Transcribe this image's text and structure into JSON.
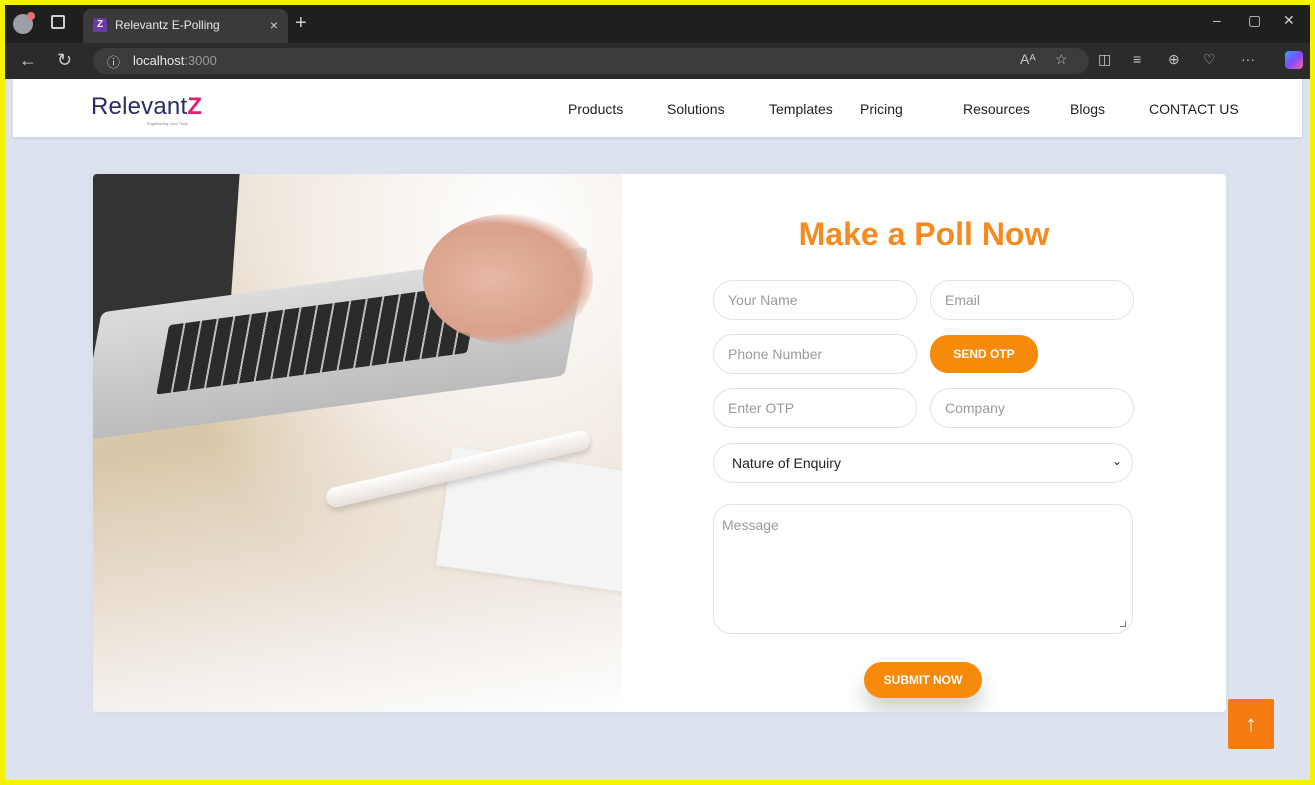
{
  "browser": {
    "tab_title": "Relevantz E-Polling",
    "tab_close": "×",
    "new_tab": "+",
    "url_host": "localhost",
    "url_port": ":3000",
    "win_min": "–",
    "win_max": "▢",
    "win_close": "✕"
  },
  "site": {
    "logo_text": "Relevant",
    "logo_mark": "Z",
    "logo_tagline": "Engineering. And Trust.",
    "nav": [
      "Products",
      "Solutions",
      "Templates",
      "Pricing",
      "Resources",
      "Blogs",
      "CONTACT US"
    ]
  },
  "form": {
    "title": "Make a Poll Now",
    "name_placeholder": "Your Name",
    "email_placeholder": "Email",
    "phone_placeholder": "Phone Number",
    "send_otp_label": "SEND OTP",
    "otp_placeholder": "Enter OTP",
    "company_placeholder": "Company",
    "enquiry_selected": "Nature of Enquiry",
    "message_placeholder": "Message",
    "submit_label": "SUBMIT NOW"
  },
  "scroll_top_icon": "↑",
  "colors": {
    "accent": "#f58a0b",
    "title": "#f58a1f",
    "page_bg": "#dde3ee",
    "frame": "#f5f200",
    "logo_mark": "#e11d74"
  }
}
